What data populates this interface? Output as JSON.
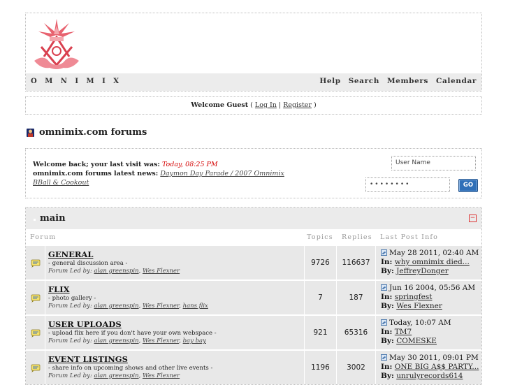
{
  "header": {
    "brand": "O M N I M I X",
    "nav": [
      "Help",
      "Search",
      "Members",
      "Calendar"
    ]
  },
  "welcome": {
    "prefix": "Welcome Guest",
    "open": "(",
    "login": "Log In",
    "sep": "|",
    "register": "Register",
    "close": ")"
  },
  "title": "omnimix.com forums",
  "login_box": {
    "last_visit_label": "Welcome back; your last visit was:",
    "last_visit_value": "Today, 08:25 PM",
    "news_label": "omnimix.com forums latest news:",
    "news_link": "Daymon Day Parade / 2007 Omnimix BBall & Cookout",
    "username_placeholder": "User Name",
    "password_value": "••••••••",
    "go_label": "GO"
  },
  "category": {
    "name": "main",
    "collapse_symbol": "−",
    "columns": {
      "forum": "Forum",
      "topics": "Topics",
      "replies": "Replies",
      "last_post": "Last Post Info"
    },
    "forums": [
      {
        "name": "GENERAL",
        "desc": "- general discussion area -",
        "lead_label": "Forum Led by:",
        "leaders": [
          "alan greenspin",
          "Wes Flexner"
        ],
        "topics": "9726",
        "replies": "116637",
        "last_date": "May 28 2011, 02:40 AM",
        "in_label": "In:",
        "in_topic": "why omnimix died...",
        "by_label": "By:",
        "by_user": "JeffreyDonger"
      },
      {
        "name": "FLIX",
        "desc": "- photo gallery -",
        "lead_label": "Forum Led by:",
        "leaders": [
          "alan greenspin",
          "Wes Flexner",
          "hans flix"
        ],
        "topics": "7",
        "replies": "187",
        "last_date": "Jun 16 2004, 05:56 AM",
        "in_label": "In:",
        "in_topic": "springfest",
        "by_label": "By:",
        "by_user": "Wes Flexner"
      },
      {
        "name": "USER UPLOADS",
        "desc": "- upload flix here if you don't have your own webspace -",
        "lead_label": "Forum Led by:",
        "leaders": [
          "alan greenspin",
          "Wes Flexner",
          "bay bay"
        ],
        "topics": "921",
        "replies": "65316",
        "last_date": "Today, 10:07 AM",
        "in_label": "In:",
        "in_topic": "TM7",
        "by_label": "By:",
        "by_user": "COMESKE"
      },
      {
        "name": "EVENT LISTINGS",
        "desc": "- share info on upcoming shows and other live events -",
        "lead_label": "Forum Led by:",
        "leaders": [
          "alan greenspin",
          "Wes Flexner"
        ],
        "topics": "1196",
        "replies": "3002",
        "last_date": "May 30 2011, 09:01 PM",
        "in_label": "In:",
        "in_topic": "ONE BIG A$$ PARTY...",
        "by_label": "By:",
        "by_user": "unrulyrecords614"
      }
    ]
  }
}
